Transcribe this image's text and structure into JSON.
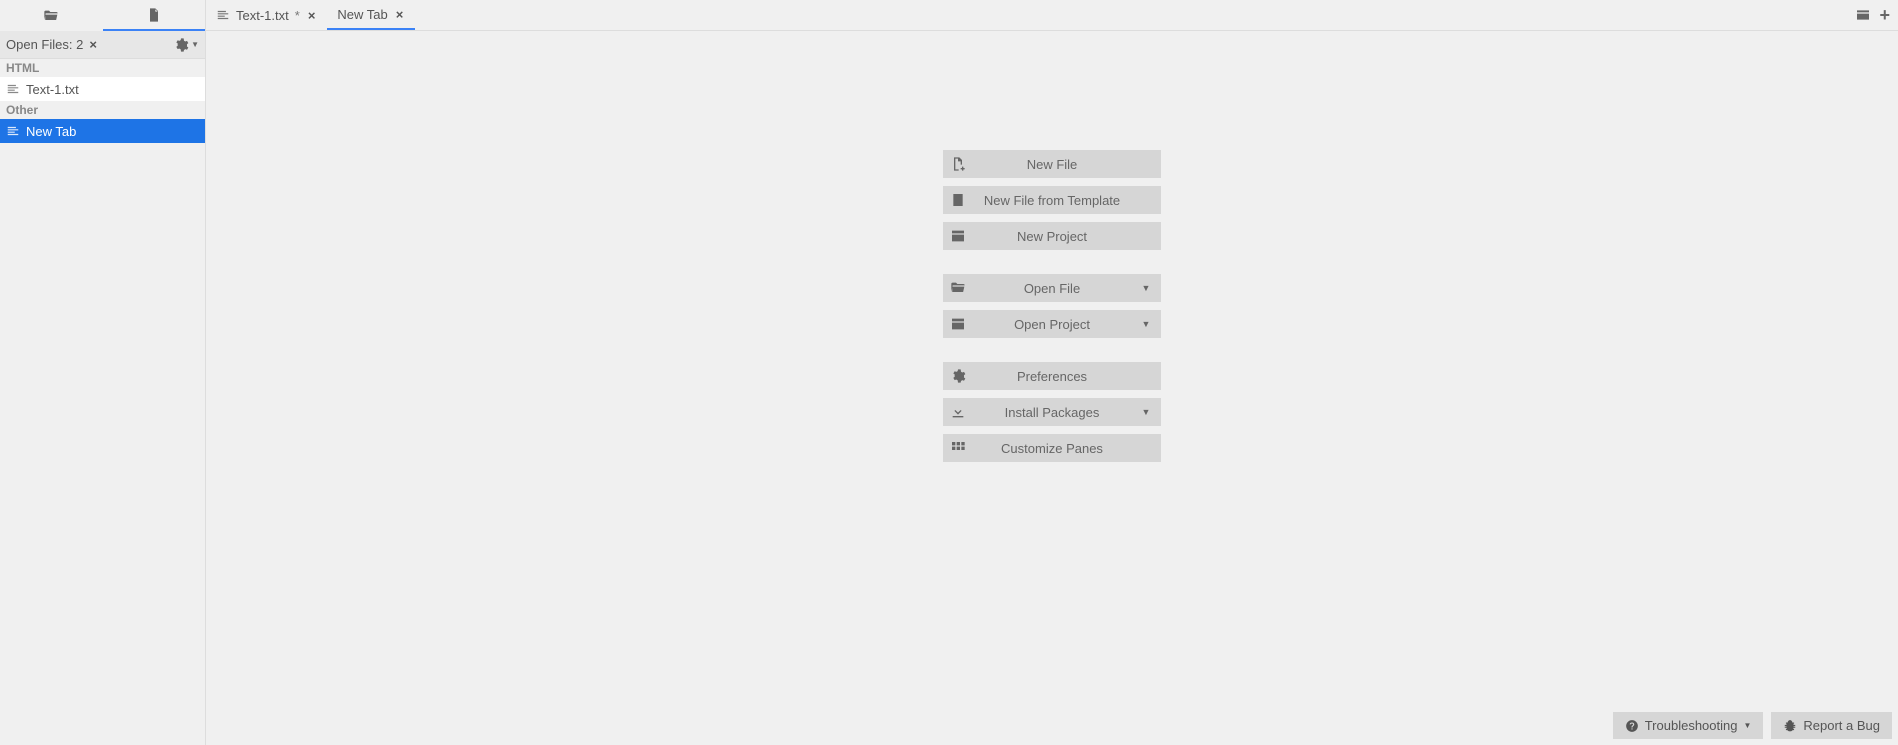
{
  "sidebar": {
    "open_files_label": "Open Files: 2",
    "groups": [
      {
        "title": "HTML",
        "items": [
          {
            "label": "Text-1.txt",
            "selected": false
          }
        ]
      },
      {
        "title": "Other",
        "items": [
          {
            "label": "New Tab",
            "selected": true
          }
        ]
      }
    ]
  },
  "tabs": [
    {
      "label": "Text-1.txt",
      "dirty": true,
      "active": false,
      "hasIcon": true
    },
    {
      "label": "New Tab",
      "dirty": false,
      "active": true,
      "hasIcon": false
    }
  ],
  "welcome": {
    "groups": [
      [
        {
          "label": "New File",
          "icon": "new-file",
          "dropdown": false
        },
        {
          "label": "New File from Template",
          "icon": "template",
          "dropdown": false
        },
        {
          "label": "New Project",
          "icon": "project",
          "dropdown": false
        }
      ],
      [
        {
          "label": "Open File",
          "icon": "folder-open",
          "dropdown": true
        },
        {
          "label": "Open Project",
          "icon": "project",
          "dropdown": true
        }
      ],
      [
        {
          "label": "Preferences",
          "icon": "gear",
          "dropdown": false
        },
        {
          "label": "Install Packages",
          "icon": "download",
          "dropdown": true
        },
        {
          "label": "Customize Panes",
          "icon": "grid",
          "dropdown": false
        }
      ]
    ]
  },
  "footer": {
    "troubleshooting": "Troubleshooting",
    "report_bug": "Report a Bug"
  }
}
